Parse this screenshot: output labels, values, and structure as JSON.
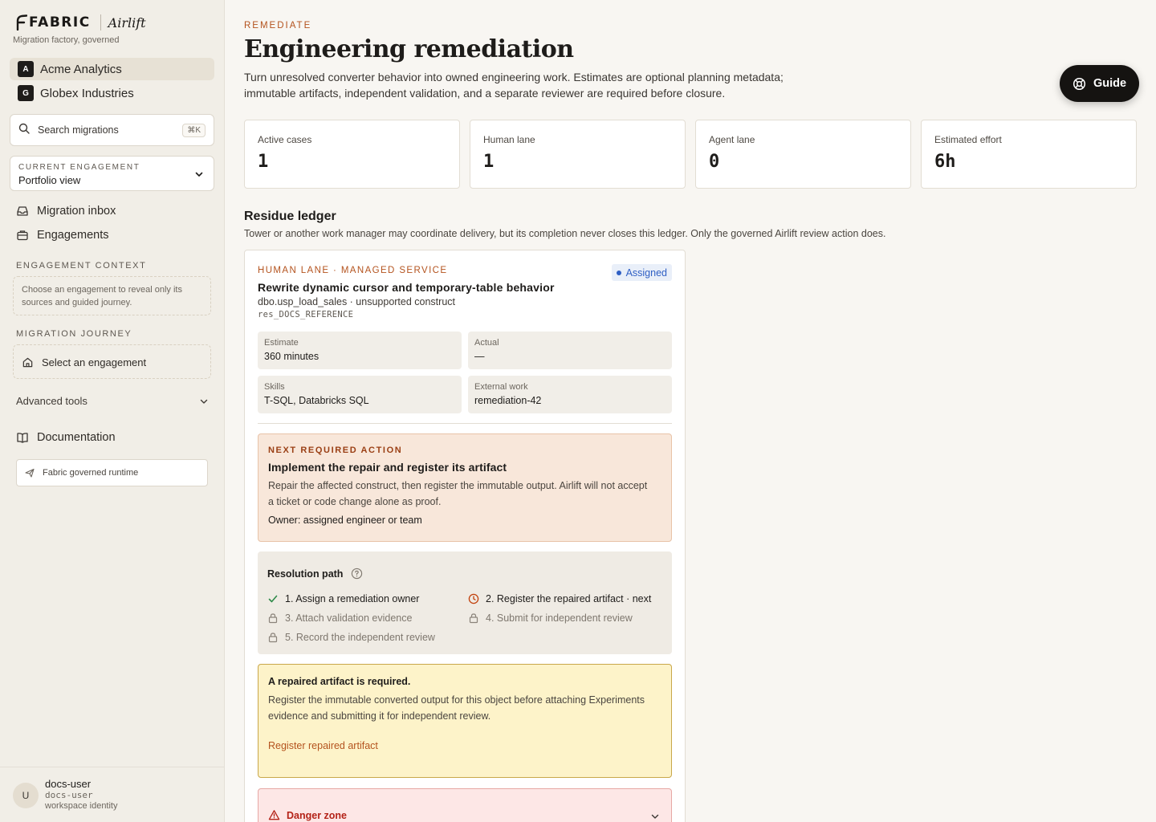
{
  "brand": {
    "name": "FABRIC",
    "product": "Airlift",
    "tagline": "Migration factory, governed"
  },
  "workspaces": [
    {
      "badge": "A",
      "name": "Acme Analytics",
      "active": true
    },
    {
      "badge": "G",
      "name": "Globex Industries",
      "active": false
    }
  ],
  "search": {
    "placeholder": "Search migrations",
    "shortcut": "⌘K"
  },
  "engagement": {
    "label": "CURRENT ENGAGEMENT",
    "value": "Portfolio view"
  },
  "nav": {
    "inbox": "Migration inbox",
    "engagements": "Engagements",
    "documentation": "Documentation"
  },
  "context": {
    "label": "ENGAGEMENT CONTEXT",
    "text": "Choose an engagement to reveal only its sources and guided journey."
  },
  "journey": {
    "label": "MIGRATION JOURNEY",
    "item": "Select an engagement"
  },
  "advanced": {
    "label": "Advanced tools"
  },
  "runtime": {
    "label": "Fabric governed runtime"
  },
  "user": {
    "initial": "U",
    "name": "docs-user",
    "id": "docs-user",
    "role": "workspace identity"
  },
  "header": {
    "eyebrow": "REMEDIATE",
    "title": "Engineering remediation",
    "description": "Turn unresolved converter behavior into owned engineering work. Estimates are optional planning metadata; immutable artifacts, independent validation, and a separate reviewer are required before closure.",
    "guide_label": "Guide"
  },
  "stats": [
    {
      "label": "Active cases",
      "value": "1"
    },
    {
      "label": "Human lane",
      "value": "1"
    },
    {
      "label": "Agent lane",
      "value": "0"
    },
    {
      "label": "Estimated effort",
      "value": "6h"
    }
  ],
  "ledger": {
    "title": "Residue ledger",
    "description": "Tower or another work manager may coordinate delivery, but its completion never closes this ledger. Only the governed Airlift review action does."
  },
  "case": {
    "lane": "HUMAN LANE · MANAGED SERVICE",
    "status": "Assigned",
    "title": "Rewrite dynamic cursor and temporary-table behavior",
    "meta": "dbo.usp_load_sales · unsupported construct",
    "ref": "res_DOCS_REFERENCE",
    "fields": {
      "estimate": {
        "label": "Estimate",
        "value": "360 minutes"
      },
      "actual": {
        "label": "Actual",
        "value": "—"
      },
      "skills": {
        "label": "Skills",
        "value": "T-SQL, Databricks SQL"
      },
      "external": {
        "label": "External work",
        "value": "remediation-42"
      }
    },
    "next_action": {
      "label": "NEXT REQUIRED ACTION",
      "title": "Implement the repair and register its artifact",
      "description": "Repair the affected construct, then register the immutable output. Airlift will not accept a ticket or code change alone as proof.",
      "owner": "Owner: assigned engineer or team"
    },
    "resolution": {
      "title": "Resolution path",
      "steps": [
        {
          "label": "1. Assign a remediation owner",
          "state": "done"
        },
        {
          "label": "2. Register the repaired artifact · next",
          "state": "next"
        },
        {
          "label": "3. Attach validation evidence",
          "state": "locked"
        },
        {
          "label": "4. Submit for independent review",
          "state": "locked"
        },
        {
          "label": "5. Record the independent review",
          "state": "locked"
        }
      ]
    },
    "warning": {
      "title": "A repaired artifact is required.",
      "description": "Register the immutable converted output for this object before attaching Experiments evidence and submitting it for independent review.",
      "link": "Register repaired artifact"
    },
    "danger": {
      "title": "Danger zone"
    }
  },
  "colors": {
    "accent": "#b4531e",
    "badge_blue": "#2f5fc4",
    "danger": "#b42318",
    "warning_bg": "#fdf3c9"
  }
}
